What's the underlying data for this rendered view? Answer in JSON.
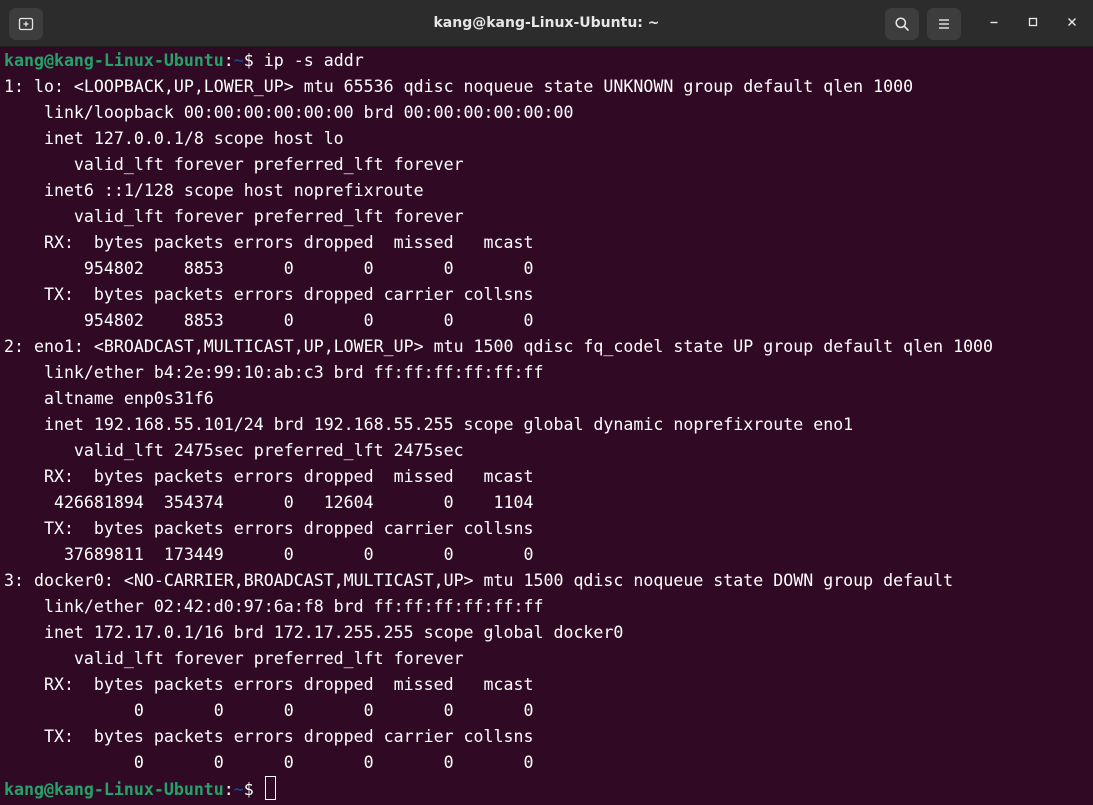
{
  "window": {
    "title": "kang@kang-Linux-Ubuntu: ~",
    "buttons": {
      "new_tab": "new-tab-icon",
      "search": "search-icon",
      "menu": "hamburger-menu-icon",
      "minimize": "minimize-icon",
      "maximize": "maximize-icon",
      "close": "close-icon"
    }
  },
  "colors": {
    "background": "#300a24",
    "titlebar": "#2c2c2c",
    "prompt_user": "#26a269",
    "prompt_path": "#12488b",
    "text": "#ffffff"
  },
  "terminal": {
    "prompt": {
      "user_host": "kang@kang-Linux-Ubuntu",
      "separator": ":",
      "path": "~",
      "symbol": "$ "
    },
    "command": "ip -s addr",
    "output": [
      "1: lo: <LOOPBACK,UP,LOWER_UP> mtu 65536 qdisc noqueue state UNKNOWN group default qlen 1000",
      "    link/loopback 00:00:00:00:00:00 brd 00:00:00:00:00:00",
      "    inet 127.0.0.1/8 scope host lo",
      "       valid_lft forever preferred_lft forever",
      "    inet6 ::1/128 scope host noprefixroute",
      "       valid_lft forever preferred_lft forever",
      "    RX:  bytes packets errors dropped  missed   mcast",
      "        954802    8853      0       0       0       0",
      "    TX:  bytes packets errors dropped carrier collsns",
      "        954802    8853      0       0       0       0",
      "2: eno1: <BROADCAST,MULTICAST,UP,LOWER_UP> mtu 1500 qdisc fq_codel state UP group default qlen 1000",
      "    link/ether b4:2e:99:10:ab:c3 brd ff:ff:ff:ff:ff:ff",
      "    altname enp0s31f6",
      "    inet 192.168.55.101/24 brd 192.168.55.255 scope global dynamic noprefixroute eno1",
      "       valid_lft 2475sec preferred_lft 2475sec",
      "    RX:  bytes packets errors dropped  missed   mcast",
      "     426681894  354374      0   12604       0    1104",
      "    TX:  bytes packets errors dropped carrier collsns",
      "      37689811  173449      0       0       0       0",
      "3: docker0: <NO-CARRIER,BROADCAST,MULTICAST,UP> mtu 1500 qdisc noqueue state DOWN group default",
      "    link/ether 02:42:d0:97:6a:f8 brd ff:ff:ff:ff:ff:ff",
      "    inet 172.17.0.1/16 brd 172.17.255.255 scope global docker0",
      "       valid_lft forever preferred_lft forever",
      "    RX:  bytes packets errors dropped  missed   mcast",
      "             0       0      0       0       0       0",
      "    TX:  bytes packets errors dropped carrier collsns",
      "             0       0      0       0       0       0"
    ]
  }
}
